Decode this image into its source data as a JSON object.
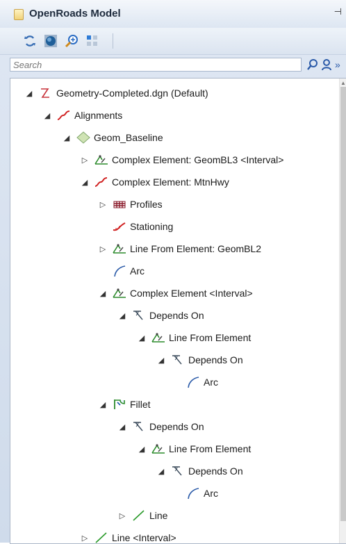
{
  "panel": {
    "title": "OpenRoads Model",
    "pin_glyph": "⊣"
  },
  "toolbar": {
    "buttons": [
      "refresh-icon",
      "globe-icon",
      "zoom-to-icon",
      "grid-view-icon"
    ]
  },
  "search": {
    "placeholder": "Search",
    "more_glyph": "»"
  },
  "tree": {
    "rows": [
      {
        "label": "Geometry-Completed.dgn (Default)",
        "expander": "◢",
        "icon": "dgn-file-icon"
      },
      {
        "label": "Alignments",
        "expander": "◢",
        "icon": "alignment-icon"
      },
      {
        "label": "Geom_Baseline",
        "expander": "◢",
        "icon": "diamond-icon"
      },
      {
        "label": "Complex Element: GeomBL3 <Interval>",
        "expander": "▷",
        "icon": "complex-element-icon"
      },
      {
        "label": "Complex Element: MtnHwy",
        "expander": "◢",
        "icon": "alignment-icon"
      },
      {
        "label": "Profiles",
        "expander": "▷",
        "icon": "profiles-icon"
      },
      {
        "label": "Stationing",
        "expander": "",
        "icon": "stationing-icon"
      },
      {
        "label": "Line From Element: GeomBL2",
        "expander": "▷",
        "icon": "complex-element-icon"
      },
      {
        "label": "Arc",
        "expander": "",
        "icon": "arc-icon"
      },
      {
        "label": "Complex Element <Interval>",
        "expander": "◢",
        "icon": "complex-element-icon"
      },
      {
        "label": "Depends On",
        "expander": "◢",
        "icon": "depends-on-icon"
      },
      {
        "label": "Line From Element",
        "expander": "◢",
        "icon": "complex-element-icon"
      },
      {
        "label": "Depends On",
        "expander": "◢",
        "icon": "depends-on-icon"
      },
      {
        "label": "Arc",
        "expander": "",
        "icon": "arc-icon"
      },
      {
        "label": "Fillet",
        "expander": "◢",
        "icon": "fillet-icon"
      },
      {
        "label": "Depends On",
        "expander": "◢",
        "icon": "depends-on-icon"
      },
      {
        "label": "Line From Element",
        "expander": "◢",
        "icon": "complex-element-icon"
      },
      {
        "label": "Depends On",
        "expander": "◢",
        "icon": "depends-on-icon"
      },
      {
        "label": "Arc",
        "expander": "",
        "icon": "arc-icon"
      },
      {
        "label": "Line",
        "expander": "▷",
        "icon": "line-icon"
      },
      {
        "label": "Line <Interval>",
        "expander": "▷",
        "icon": "line-icon"
      }
    ]
  }
}
